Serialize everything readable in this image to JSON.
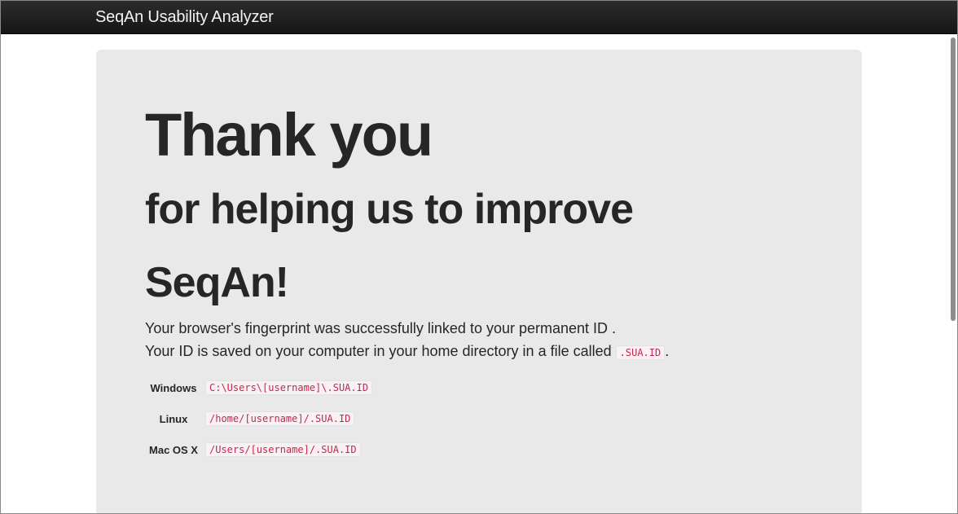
{
  "navbar": {
    "brand": "SeqAn Usability Analyzer"
  },
  "main": {
    "headline": "Thank you",
    "subheadline_1": "for helping us to improve",
    "subheadline_2": "SeqAn!",
    "paragraph_1": "Your browser's fingerprint was successfully linked to your permanent ID .",
    "paragraph_2_prefix": "Your ID is saved on your computer in your home directory in a file called",
    "paragraph_2_code": ".SUA.ID",
    "paragraph_2_suffix": ".",
    "locations": [
      {
        "os": "Windows",
        "path": "C:\\Users\\[username]\\.SUA.ID"
      },
      {
        "os": "Linux",
        "path": "/home/[username]/.SUA.ID"
      },
      {
        "os": "Mac OS X",
        "path": "/Users/[username]/.SUA.ID"
      }
    ]
  },
  "colors": {
    "navbar_bg": "#1b1b1b",
    "jumbotron_bg": "#e9e9e9",
    "code_text": "#c7254e"
  }
}
